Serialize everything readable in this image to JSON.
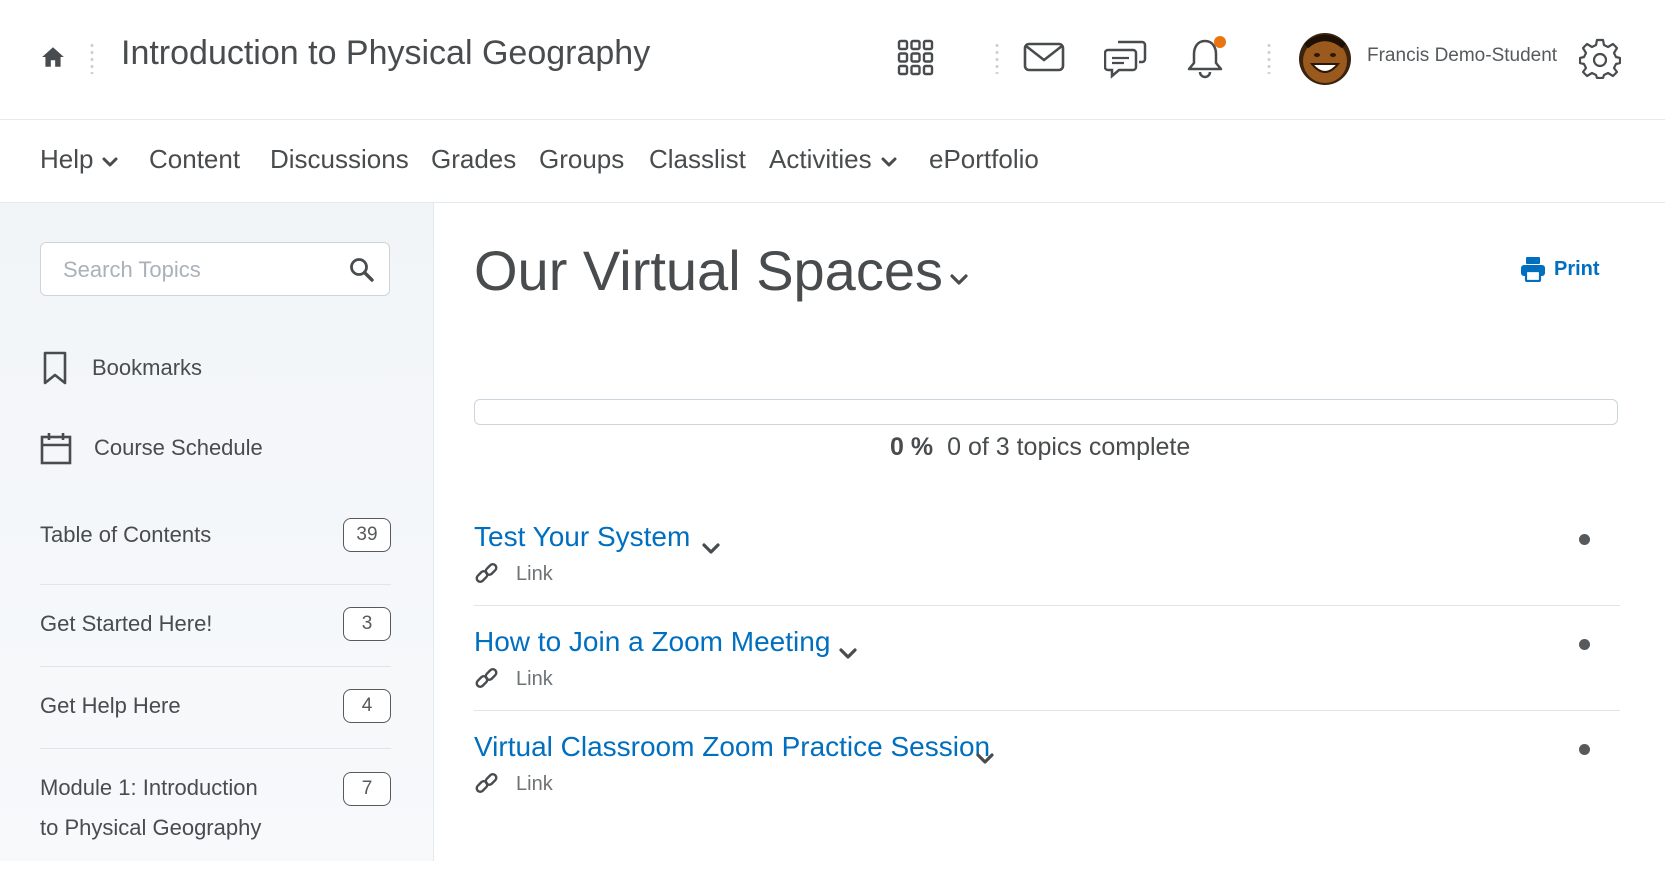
{
  "header": {
    "course_title": "Introduction to Physical Geography",
    "user_name": "Francis Demo-Student",
    "icons": [
      "home-icon",
      "waffle-grid-icon",
      "mail-icon",
      "chat-icon",
      "bell-icon",
      "gear-icon"
    ],
    "notification_color": "#e87511"
  },
  "nav": {
    "items": [
      {
        "label": "Help",
        "dropdown": true
      },
      {
        "label": "Content",
        "dropdown": false
      },
      {
        "label": "Discussions",
        "dropdown": false
      },
      {
        "label": "Grades",
        "dropdown": false
      },
      {
        "label": "Groups",
        "dropdown": false
      },
      {
        "label": "Classlist",
        "dropdown": false
      },
      {
        "label": "Activities",
        "dropdown": true
      },
      {
        "label": "ePortfolio",
        "dropdown": false
      }
    ]
  },
  "sidebar": {
    "search_placeholder": "Search Topics",
    "bookmarks_label": "Bookmarks",
    "schedule_label": "Course Schedule",
    "toc": [
      {
        "label": "Table of Contents",
        "count": "39"
      },
      {
        "label": "Get Started Here!",
        "count": "3"
      },
      {
        "label": "Get Help Here",
        "count": "4"
      },
      {
        "label": "Module 1: Introduction to Physical Geography",
        "count": "7"
      }
    ]
  },
  "main": {
    "title": "Our Virtual Spaces",
    "print_label": "Print",
    "progress": {
      "percent_label": "0 %",
      "summary": "0 of 3 topics complete",
      "fraction": 0
    },
    "topics": [
      {
        "title": "Test Your System",
        "type": "Link"
      },
      {
        "title": "How to Join a Zoom Meeting",
        "type": "Link"
      },
      {
        "title": "Virtual Classroom Zoom Practice Session",
        "type": "Link"
      }
    ]
  },
  "colors": {
    "accent": "#006fbf",
    "text": "#494c4e",
    "border": "#e3e9f1"
  }
}
